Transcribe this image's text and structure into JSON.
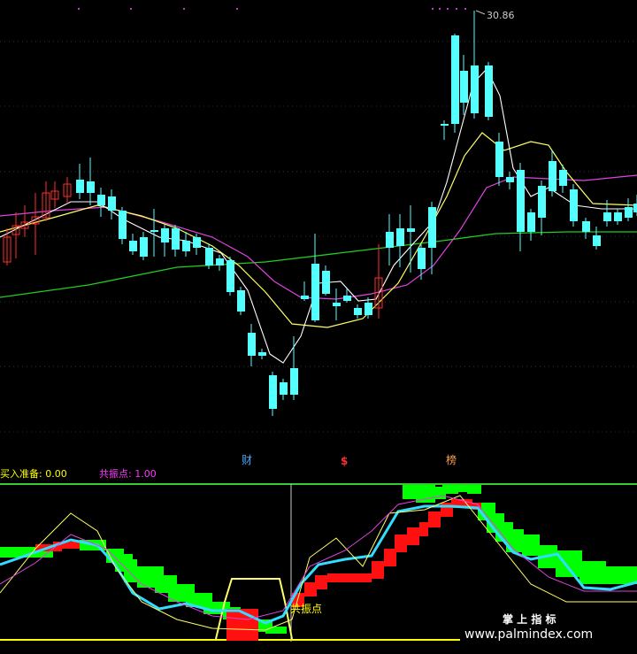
{
  "chart_data": [
    {
      "type": "candlestick",
      "overlays": [
        "moving-average",
        "moving-average",
        "moving-average",
        "moving-average"
      ],
      "price_high_label": "30.86",
      "event_markers": [
        {
          "label": "财",
          "color": "#4aa8ff"
        },
        {
          "label": "$",
          "color": "#ff3030"
        },
        {
          "label": "榜",
          "color": "#ff9f40"
        }
      ],
      "grid": "dotted-horizontal",
      "colors": {
        "up": "#ff3030",
        "down": "#54ffff",
        "ma_white": "#ffffff",
        "ma_yellow": "#ffff66",
        "ma_magenta": "#dd44dd",
        "ma_green": "#22cc22"
      }
    },
    {
      "type": "indicator",
      "series": [
        {
          "name": "买入准备",
          "value": "0.00",
          "color": "#ffff00"
        },
        {
          "name": "共振点",
          "value": "1.00",
          "color": "#ff33ff"
        }
      ],
      "annotation": "共振点",
      "colors": {
        "bull_block": "#ff1010",
        "bear_block": "#00ff00",
        "main_line": "#33ddff",
        "aux_line": "#ffff66",
        "aux_line2": "#dd44dd",
        "border": "#33cc33"
      }
    }
  ],
  "watermark": {
    "line1": "掌 上 指 标",
    "line2": "www.palmindex.com"
  }
}
